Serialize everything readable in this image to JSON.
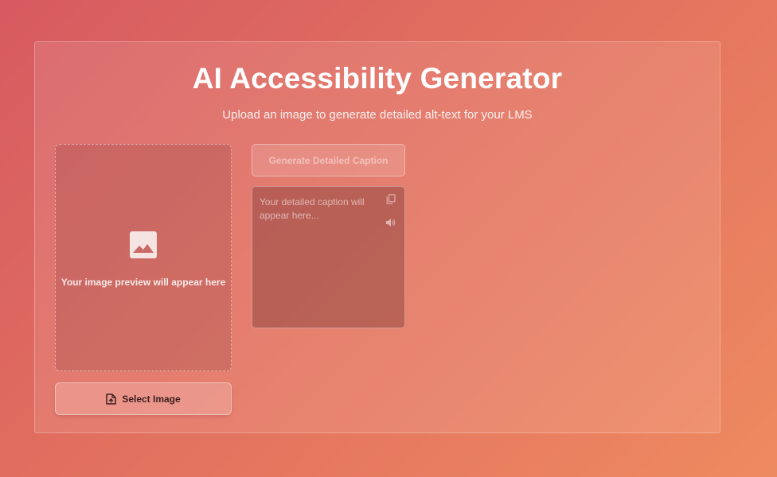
{
  "header": {
    "title": "AI Accessibility Generator",
    "subtitle": "Upload an image to generate detailed alt-text for your LMS"
  },
  "preview": {
    "icon": "image-icon",
    "placeholder": "Your image preview will appear here"
  },
  "actions": {
    "select_label": "Select Image",
    "select_icon": "file-upload-icon",
    "generate_label": "Generate Detailed Caption"
  },
  "caption": {
    "placeholder": "Your detailed caption will appear here...",
    "copy_icon": "copy-icon",
    "speak_icon": "speaker-icon"
  },
  "colors": {
    "background_start": "#d65a60",
    "background_end": "#ee8a60",
    "title": "#ffffff"
  }
}
